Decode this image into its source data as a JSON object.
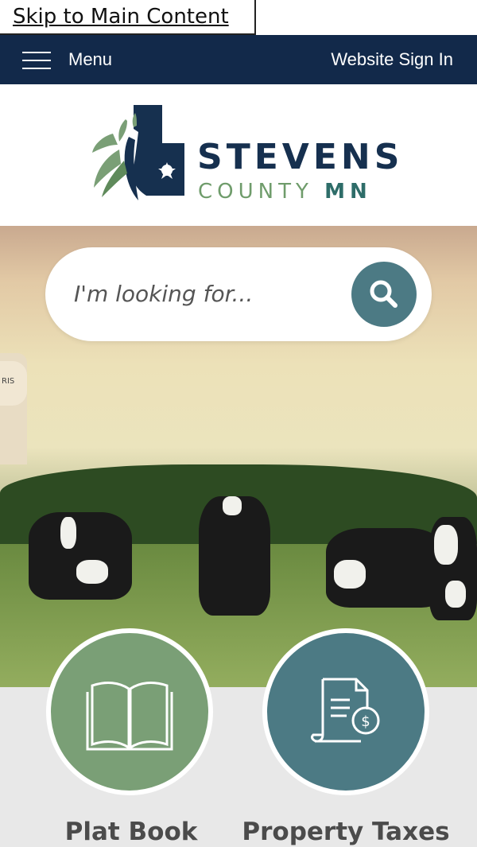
{
  "skip_link": "Skip to Main Content",
  "header": {
    "menu_label": "Menu",
    "signin_label": "Website Sign In"
  },
  "logo": {
    "title": "STEVENS",
    "sub_county": "COUNTY",
    "sub_state": "MN"
  },
  "search": {
    "placeholder": "I'm looking for..."
  },
  "quick_links": [
    {
      "label": "Plat Book",
      "icon": "book-icon"
    },
    {
      "label": "Property Taxes",
      "icon": "tax-document-icon"
    }
  ],
  "colors": {
    "navy": "#12294a",
    "green": "#7a9f76",
    "teal": "#4c7a84"
  }
}
